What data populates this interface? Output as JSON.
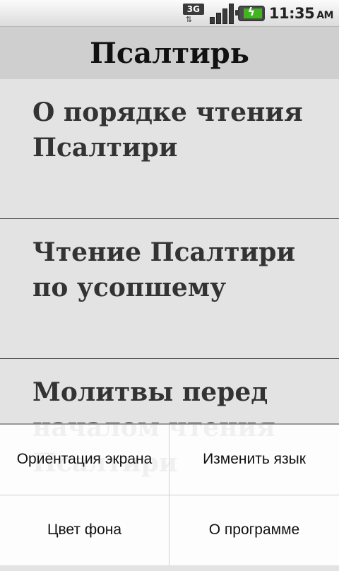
{
  "status_bar": {
    "network_label": "3G",
    "network_arrows": "⇅",
    "battery_icon": "battery-charging-icon",
    "time": "11:35",
    "ampm": "AM"
  },
  "title": "Псалтирь",
  "list": {
    "items": [
      {
        "label": "О порядке чтения Псалтири"
      },
      {
        "label": "Чтение Псалтири по усопшему"
      },
      {
        "label": "Молитвы перед началом чтения Псалтири"
      }
    ]
  },
  "menu": {
    "items": [
      {
        "label": "Ориентация экрана"
      },
      {
        "label": "Изменить язык"
      },
      {
        "label": "Цвет фона"
      },
      {
        "label": "О программе"
      }
    ]
  }
}
